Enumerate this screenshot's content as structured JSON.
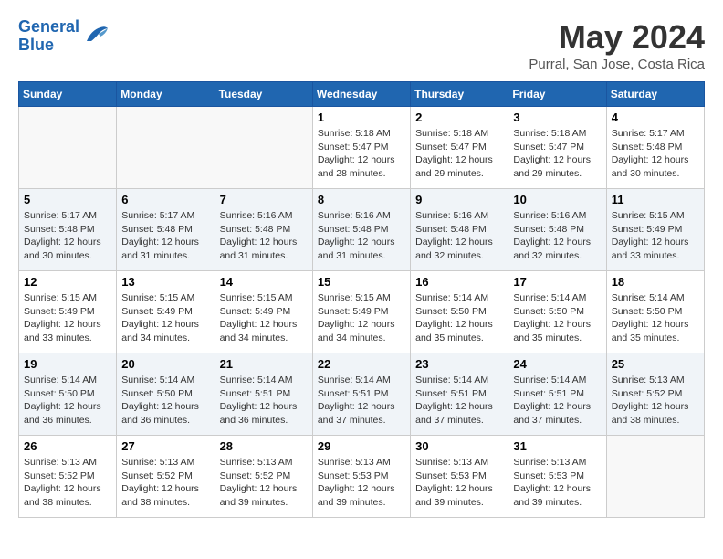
{
  "logo": {
    "line1": "General",
    "line2": "Blue"
  },
  "title": "May 2024",
  "location": "Purral, San Jose, Costa Rica",
  "days_of_week": [
    "Sunday",
    "Monday",
    "Tuesday",
    "Wednesday",
    "Thursday",
    "Friday",
    "Saturday"
  ],
  "weeks": [
    [
      {
        "day": "",
        "info": ""
      },
      {
        "day": "",
        "info": ""
      },
      {
        "day": "",
        "info": ""
      },
      {
        "day": "1",
        "info": "Sunrise: 5:18 AM\nSunset: 5:47 PM\nDaylight: 12 hours\nand 28 minutes."
      },
      {
        "day": "2",
        "info": "Sunrise: 5:18 AM\nSunset: 5:47 PM\nDaylight: 12 hours\nand 29 minutes."
      },
      {
        "day": "3",
        "info": "Sunrise: 5:18 AM\nSunset: 5:47 PM\nDaylight: 12 hours\nand 29 minutes."
      },
      {
        "day": "4",
        "info": "Sunrise: 5:17 AM\nSunset: 5:48 PM\nDaylight: 12 hours\nand 30 minutes."
      }
    ],
    [
      {
        "day": "5",
        "info": "Sunrise: 5:17 AM\nSunset: 5:48 PM\nDaylight: 12 hours\nand 30 minutes."
      },
      {
        "day": "6",
        "info": "Sunrise: 5:17 AM\nSunset: 5:48 PM\nDaylight: 12 hours\nand 31 minutes."
      },
      {
        "day": "7",
        "info": "Sunrise: 5:16 AM\nSunset: 5:48 PM\nDaylight: 12 hours\nand 31 minutes."
      },
      {
        "day": "8",
        "info": "Sunrise: 5:16 AM\nSunset: 5:48 PM\nDaylight: 12 hours\nand 31 minutes."
      },
      {
        "day": "9",
        "info": "Sunrise: 5:16 AM\nSunset: 5:48 PM\nDaylight: 12 hours\nand 32 minutes."
      },
      {
        "day": "10",
        "info": "Sunrise: 5:16 AM\nSunset: 5:48 PM\nDaylight: 12 hours\nand 32 minutes."
      },
      {
        "day": "11",
        "info": "Sunrise: 5:15 AM\nSunset: 5:49 PM\nDaylight: 12 hours\nand 33 minutes."
      }
    ],
    [
      {
        "day": "12",
        "info": "Sunrise: 5:15 AM\nSunset: 5:49 PM\nDaylight: 12 hours\nand 33 minutes."
      },
      {
        "day": "13",
        "info": "Sunrise: 5:15 AM\nSunset: 5:49 PM\nDaylight: 12 hours\nand 34 minutes."
      },
      {
        "day": "14",
        "info": "Sunrise: 5:15 AM\nSunset: 5:49 PM\nDaylight: 12 hours\nand 34 minutes."
      },
      {
        "day": "15",
        "info": "Sunrise: 5:15 AM\nSunset: 5:49 PM\nDaylight: 12 hours\nand 34 minutes."
      },
      {
        "day": "16",
        "info": "Sunrise: 5:14 AM\nSunset: 5:50 PM\nDaylight: 12 hours\nand 35 minutes."
      },
      {
        "day": "17",
        "info": "Sunrise: 5:14 AM\nSunset: 5:50 PM\nDaylight: 12 hours\nand 35 minutes."
      },
      {
        "day": "18",
        "info": "Sunrise: 5:14 AM\nSunset: 5:50 PM\nDaylight: 12 hours\nand 35 minutes."
      }
    ],
    [
      {
        "day": "19",
        "info": "Sunrise: 5:14 AM\nSunset: 5:50 PM\nDaylight: 12 hours\nand 36 minutes."
      },
      {
        "day": "20",
        "info": "Sunrise: 5:14 AM\nSunset: 5:50 PM\nDaylight: 12 hours\nand 36 minutes."
      },
      {
        "day": "21",
        "info": "Sunrise: 5:14 AM\nSunset: 5:51 PM\nDaylight: 12 hours\nand 36 minutes."
      },
      {
        "day": "22",
        "info": "Sunrise: 5:14 AM\nSunset: 5:51 PM\nDaylight: 12 hours\nand 37 minutes."
      },
      {
        "day": "23",
        "info": "Sunrise: 5:14 AM\nSunset: 5:51 PM\nDaylight: 12 hours\nand 37 minutes."
      },
      {
        "day": "24",
        "info": "Sunrise: 5:14 AM\nSunset: 5:51 PM\nDaylight: 12 hours\nand 37 minutes."
      },
      {
        "day": "25",
        "info": "Sunrise: 5:13 AM\nSunset: 5:52 PM\nDaylight: 12 hours\nand 38 minutes."
      }
    ],
    [
      {
        "day": "26",
        "info": "Sunrise: 5:13 AM\nSunset: 5:52 PM\nDaylight: 12 hours\nand 38 minutes."
      },
      {
        "day": "27",
        "info": "Sunrise: 5:13 AM\nSunset: 5:52 PM\nDaylight: 12 hours\nand 38 minutes."
      },
      {
        "day": "28",
        "info": "Sunrise: 5:13 AM\nSunset: 5:52 PM\nDaylight: 12 hours\nand 39 minutes."
      },
      {
        "day": "29",
        "info": "Sunrise: 5:13 AM\nSunset: 5:53 PM\nDaylight: 12 hours\nand 39 minutes."
      },
      {
        "day": "30",
        "info": "Sunrise: 5:13 AM\nSunset: 5:53 PM\nDaylight: 12 hours\nand 39 minutes."
      },
      {
        "day": "31",
        "info": "Sunrise: 5:13 AM\nSunset: 5:53 PM\nDaylight: 12 hours\nand 39 minutes."
      },
      {
        "day": "",
        "info": ""
      }
    ]
  ]
}
